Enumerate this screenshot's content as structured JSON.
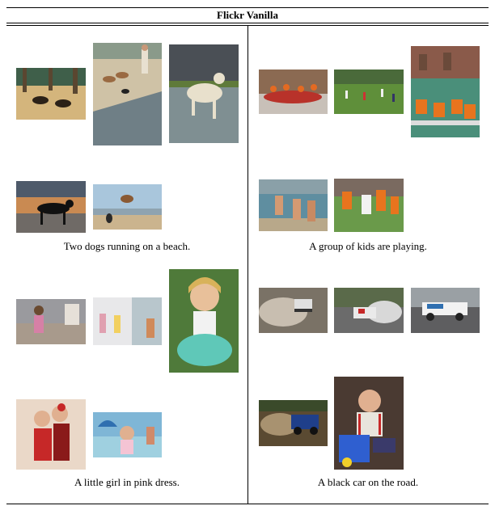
{
  "figure": {
    "title": "Flickr Vanilla",
    "cells": [
      {
        "caption": "Two dogs running on a beach.",
        "top_images": [
          "dogs-on-sand-photo",
          "beach-dogs-and-person-photo",
          "white-dog-splashing-photo"
        ],
        "bottom_images": [
          "dog-silhouette-sunset-photo",
          "dog-jumping-beach-photo"
        ]
      },
      {
        "caption": "A group of kids are playing.",
        "top_images": [
          "rafting-group-photo",
          "kids-field-play-photo",
          "boat-crew-lifejackets-photo"
        ],
        "bottom_images": [
          "kids-water-photo",
          "football-players-photo"
        ]
      },
      {
        "caption": "A little girl in pink dress.",
        "top_images": [
          "girl-pink-outfit-photo",
          "kids-doorway-photo",
          "laughing-girl-tutu-photo"
        ],
        "bottom_images": [
          "girls-red-dress-photo",
          "girl-pool-umbrella-photo"
        ]
      },
      {
        "caption": "A black car on the road.",
        "top_images": [
          "rally-car-dust-photo",
          "rally-car-smoke-photo",
          "race-car-track-photo"
        ],
        "bottom_images": [
          "blue-truck-mud-photo",
          "toddler-toy-car-photo"
        ]
      }
    ]
  },
  "colors": {
    "sand": "#d8b77a",
    "sea": "#5f7f95",
    "sky": "#9fb7c9",
    "grass": "#5f8f3a",
    "water": "#3f8f7a",
    "orange": "#e86a1e",
    "pink": "#e7a0bb",
    "red": "#c62828",
    "asphalt": "#6b6b6b"
  }
}
